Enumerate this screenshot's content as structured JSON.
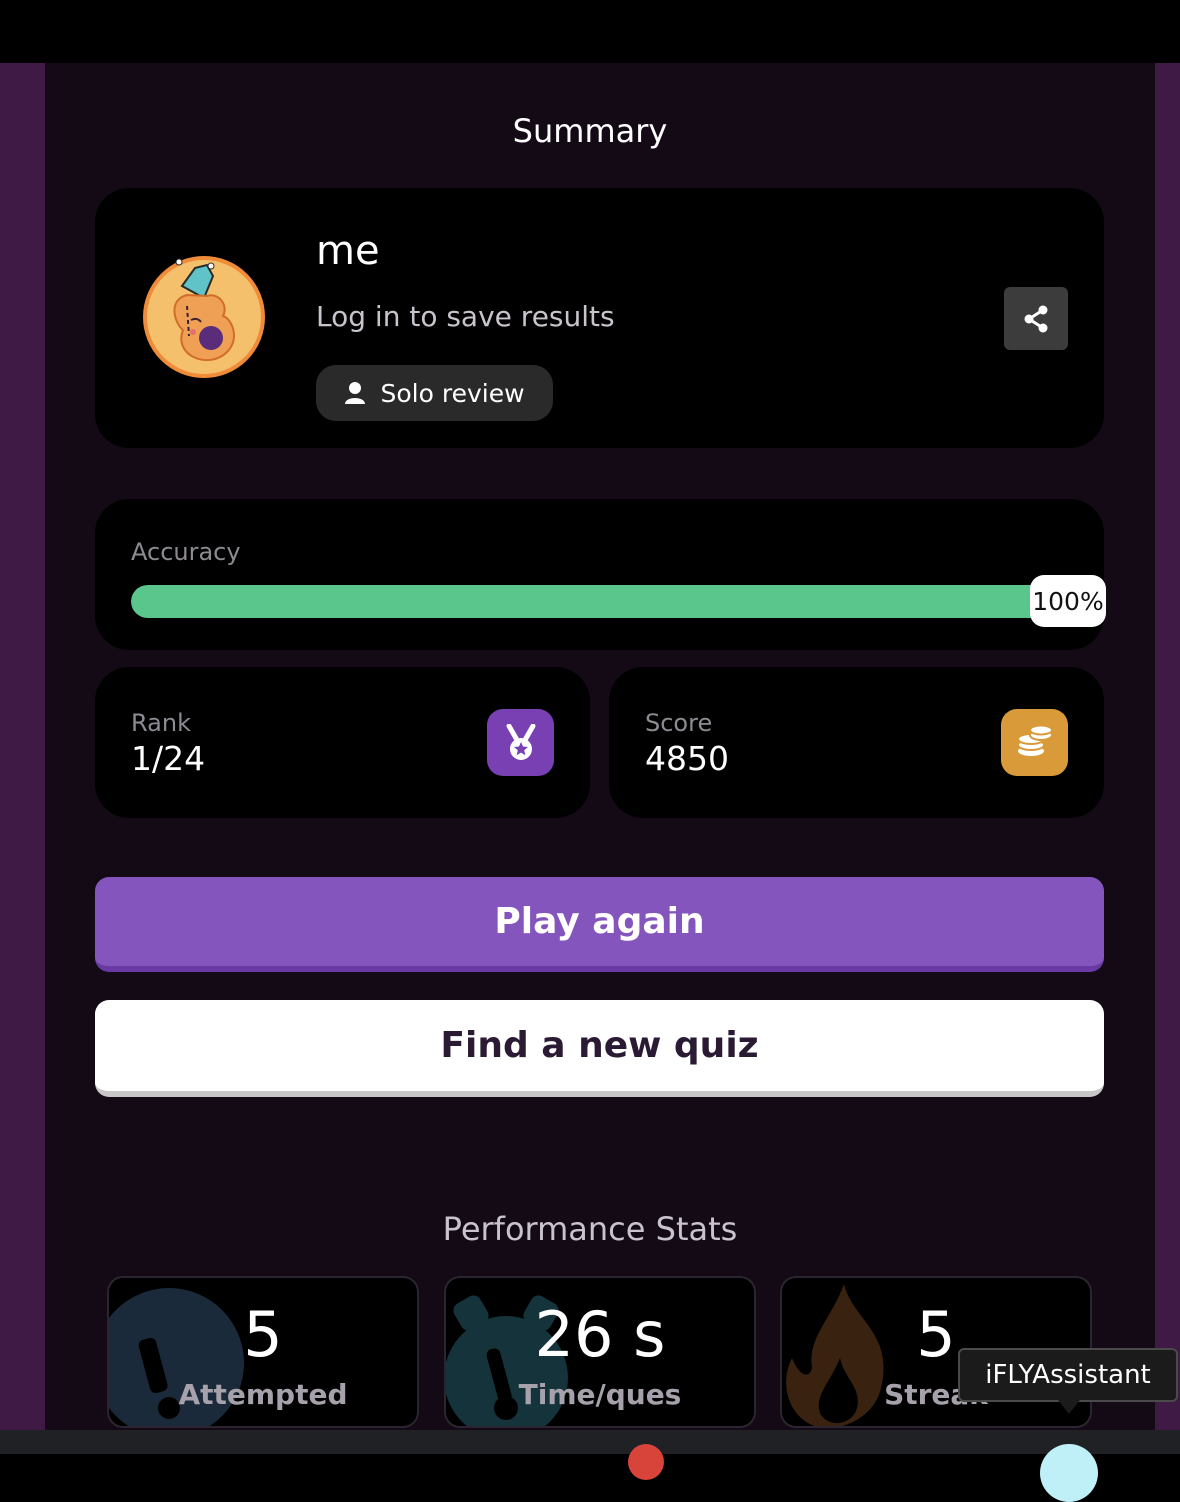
{
  "page": {
    "title": "Summary"
  },
  "profile": {
    "username": "me",
    "login_prompt": "Log in to save results",
    "mode_label": "Solo review"
  },
  "accuracy": {
    "label": "Accuracy",
    "percent_label": "100%",
    "percent_value": 100
  },
  "rank": {
    "label": "Rank",
    "value": "1/24"
  },
  "score": {
    "label": "Score",
    "value": "4850"
  },
  "actions": {
    "play_again": "Play again",
    "find_quiz": "Find a new quiz"
  },
  "performance": {
    "title": "Performance Stats",
    "items": [
      {
        "value": "5",
        "label": "Attempted",
        "icon": "exclamation-icon"
      },
      {
        "value": "26 s",
        "label": "Time/ques",
        "icon": "stopwatch-icon"
      },
      {
        "value": "5",
        "label": "Streak",
        "icon": "flame-icon"
      }
    ]
  },
  "tooltip": {
    "text": "iFLYAssistant"
  },
  "colors": {
    "accent_purple": "#8455bd",
    "progress_green": "#5ac68b",
    "badge_purple": "#7940b3",
    "badge_gold": "#d99a39"
  }
}
